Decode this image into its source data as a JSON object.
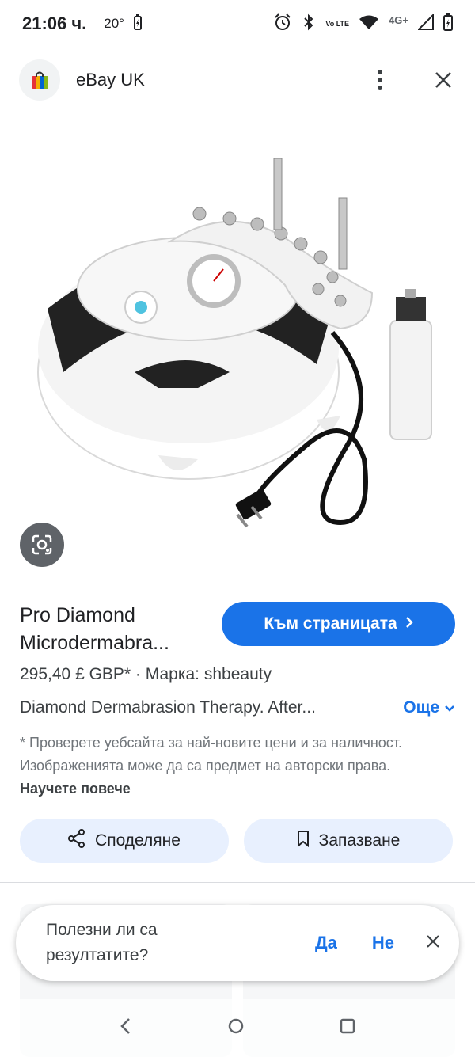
{
  "status_bar": {
    "time": "21:06 ч.",
    "temperature": "20°",
    "network": "4G+",
    "volte": "Vo LTE"
  },
  "header": {
    "site_name": "eBay UK",
    "icons": [
      "shopping-bag-icon",
      "more-vert-icon",
      "close-icon"
    ]
  },
  "hero": {
    "description_icon": "microdermabrasion-machine-image",
    "lens_icon": "google-lens-icon"
  },
  "product": {
    "title_line1": "Pro Diamond",
    "title_line2": "Microdermabra...",
    "visit_label": "Към страницата",
    "price_brand": "295,40 £ GBP* · Марка: shbeauty",
    "description": "Diamond Dermabrasion Therapy. After...",
    "more_label": "Още",
    "disclaimer": "* Проверете уебсайта за най-новите цени и за наличност. Изображенията може да са предмет на авторски права.",
    "learn_more": "Научете повече"
  },
  "actions": {
    "share_label": "Споделяне",
    "save_label": "Запазване"
  },
  "feedback": {
    "question": "Полезни ли са резултатите?",
    "yes_label": "Да",
    "no_label": "Не"
  },
  "colors": {
    "accent": "#1a73e8",
    "chip_bg": "#e8f0fe",
    "text_primary": "#202124",
    "text_secondary": "#70757a"
  }
}
